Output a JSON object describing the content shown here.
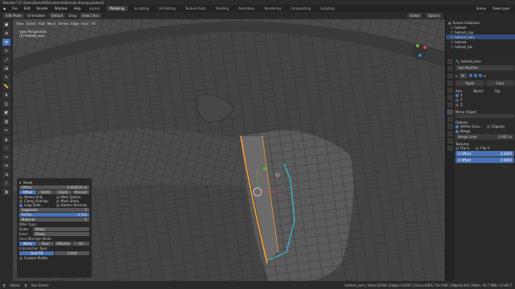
{
  "window_title": "Blender* [C:\\Users\\Daniel\\Documents\\blender.doompuy.blend]",
  "menu": [
    "File",
    "Edit",
    "Render",
    "Window",
    "Help"
  ],
  "workspaces": [
    "Layout",
    "Modeling",
    "Sculpting",
    "UV Editing",
    "Texture Paint",
    "Shading",
    "Animation",
    "Rendering",
    "Compositing",
    "Scripting"
  ],
  "active_workspace": "Modeling",
  "scene": "Scene",
  "view_layer": "View Layer",
  "header": {
    "mode": "Edit Mode",
    "orientation": "Orientation",
    "default": "Default",
    "drag": "Drag",
    "select": "Select Box",
    "global": "Global",
    "options": "Options"
  },
  "subheader": [
    "View",
    "Select",
    "Add",
    "Mesh",
    "Vertex",
    "Edge",
    "Face",
    "UV"
  ],
  "overlay": {
    "view": "User Perspective",
    "object": "(1) helmet_ears"
  },
  "outliner": {
    "title": "Scene Collection",
    "items": [
      "helmet",
      "helmet_cap",
      "helmet_ears",
      "helmet",
      "helmet_bis"
    ]
  },
  "properties": {
    "object": "helmet_ears",
    "add_modifier": "Add Modifier",
    "mod_name": "Mi",
    "apply": "Apply",
    "copy": "Copy",
    "axis": "Axis",
    "bisect": "Bisect",
    "flip": "Flip",
    "axes": [
      "X",
      "Y",
      "Z"
    ],
    "mirror_object": "Mirror Object",
    "options": "Options",
    "vertex_groups": "Vertex Grou...",
    "clipping": "Clipping",
    "merge": "Merge",
    "merge_limit": "Merge Limit",
    "merge_value": "0.001 m",
    "textures": "Textures",
    "flip_u": "Flip U",
    "flip_v": "Flip V",
    "uoff": "U Offset",
    "uoff_val": "0.0000",
    "voff": "V Offset",
    "voff_val": "0.0000"
  },
  "operator": {
    "title": "Bevel",
    "offset_label": "Offset",
    "offset_value": "0.003515 m",
    "width_type": [
      "Offset",
      "Width",
      "Depth",
      "Percent"
    ],
    "checks_left": [
      "Vertex Only",
      "Clamp Overlap",
      "Loop Slide"
    ],
    "checks_right": [
      "Mark Seams",
      "Mark Sharp",
      "Harden Normals"
    ],
    "checks_on": [
      "Loop Slide"
    ],
    "segments_label": "Segments",
    "segments_value": "1",
    "profile_label": "Profile",
    "profile_value": "0.500",
    "material_label": "Material",
    "material_value": "-1",
    "miter_type": "Miter Type:",
    "outer_label": "Outer",
    "outer_value": "Sharp",
    "inner_label": "Inner",
    "inner_value": "Sharp",
    "face_strength": "Face Strength Mode",
    "face_modes": [
      "None",
      "New",
      "Affected",
      "All"
    ],
    "intersection": "Intersection Type:",
    "int_modes": [
      "Grid Fill",
      "Cutoff"
    ],
    "custom_profile": "Custom Profile"
  },
  "status": {
    "left": "Select",
    "mid": "Box Select",
    "stats": "helmet_ears | Verts:0/168 | Edges:12/247 | Faces:0/80 | Tris:160 | Objects:0/4 | Mem: 40.7 MiB | v2.82.7"
  },
  "colors": {
    "accent": "#4772b3",
    "edge_select": "#ff9f2e",
    "seam": "#2ec4d6"
  }
}
